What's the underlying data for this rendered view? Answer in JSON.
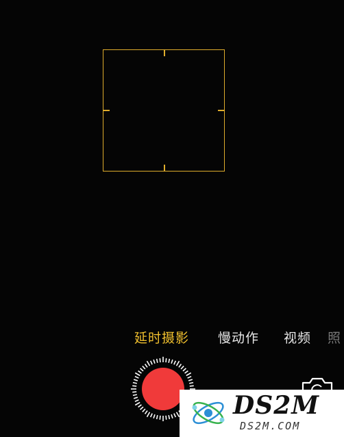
{
  "camera": {
    "modes": [
      {
        "label": "延时摄影",
        "active": true
      },
      {
        "label": "慢动作",
        "active": false
      },
      {
        "label": "视频",
        "active": false
      },
      {
        "label": "照",
        "active": false
      }
    ],
    "accent_color": "#e0ad2c",
    "shutter_color": "#f03a3a",
    "icons": {
      "shutter": "record-shutter-icon",
      "flip": "flip-camera-icon"
    }
  },
  "watermark": {
    "brand": "DS2M",
    "domain": "DS2M.COM"
  }
}
